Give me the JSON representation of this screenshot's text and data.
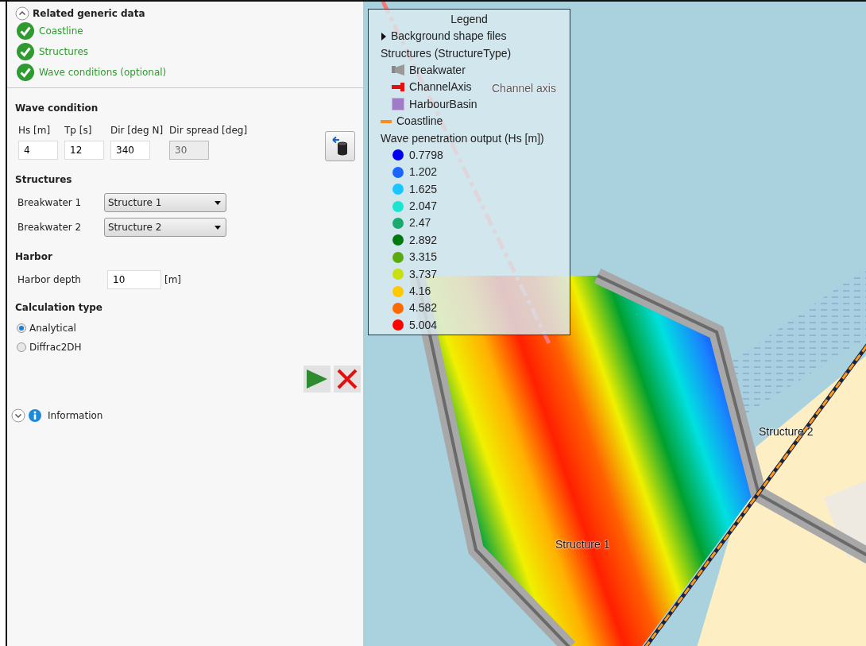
{
  "related_data": {
    "title": "Related generic data",
    "expanded": true,
    "items": [
      {
        "label": "Coastline",
        "ok": true
      },
      {
        "label": "Structures",
        "ok": true
      },
      {
        "label": "Wave conditions (optional)",
        "ok": true
      }
    ]
  },
  "wave_condition": {
    "title": "Wave condition",
    "fields": [
      {
        "label": "Hs [m]",
        "value": "4",
        "disabled": false
      },
      {
        "label": "Tp [s]",
        "value": "12",
        "disabled": false
      },
      {
        "label": "Dir [deg N]",
        "value": "340",
        "disabled": false
      },
      {
        "label": "Dir spread [deg]",
        "value": "30",
        "disabled": true
      }
    ]
  },
  "structures": {
    "title": "Structures",
    "rows": [
      {
        "label": "Breakwater 1",
        "value": "Structure 1"
      },
      {
        "label": "Breakwater 2",
        "value": "Structure 2"
      }
    ]
  },
  "harbor": {
    "title": "Harbor",
    "label": "Harbor depth",
    "value": "10",
    "unit": "[m]"
  },
  "calculation_type": {
    "title": "Calculation type",
    "options": [
      {
        "label": "Analytical",
        "selected": true
      },
      {
        "label": "Diffrac2DH",
        "selected": false
      }
    ]
  },
  "information": {
    "title": "Information",
    "expanded": false
  },
  "legend": {
    "title": "Legend",
    "entries": [
      {
        "kind": "expander",
        "label": "Background shape files",
        "expanded": false
      },
      {
        "kind": "group",
        "label": "Structures (StructureType)",
        "children": [
          {
            "kind": "breakwater",
            "label": "Breakwater"
          },
          {
            "kind": "channel",
            "label": "ChannelAxis"
          },
          {
            "kind": "basin",
            "label": "HarbourBasin"
          }
        ]
      },
      {
        "kind": "line",
        "label": "Coastline",
        "color": "#ff8c1a"
      },
      {
        "kind": "group",
        "label": "Wave penetration output (Hs [m])",
        "children": [
          {
            "kind": "dot",
            "label": "0.7798",
            "color": "#0000ee"
          },
          {
            "kind": "dot",
            "label": "1.202",
            "color": "#1a66ff"
          },
          {
            "kind": "dot",
            "label": "1.625",
            "color": "#1ac6ff"
          },
          {
            "kind": "dot",
            "label": "2.047",
            "color": "#1ae6d0"
          },
          {
            "kind": "dot",
            "label": "2.47",
            "color": "#1aaa70"
          },
          {
            "kind": "dot",
            "label": "2.892",
            "color": "#007a10"
          },
          {
            "kind": "dot",
            "label": "3.315",
            "color": "#5aaa10"
          },
          {
            "kind": "dot",
            "label": "3.737",
            "color": "#c8e010"
          },
          {
            "kind": "dot",
            "label": "4.16",
            "color": "#ffc800"
          },
          {
            "kind": "dot",
            "label": "4.582",
            "color": "#ff6a00"
          },
          {
            "kind": "dot",
            "label": "5.004",
            "color": "#ff0000"
          }
        ]
      }
    ]
  },
  "map": {
    "labels": [
      {
        "kind": "channel",
        "text": "Channel axis"
      },
      {
        "kind": "structure_1",
        "text": "Structure 1"
      },
      {
        "kind": "structure_2",
        "text": "Structure 2"
      }
    ]
  }
}
